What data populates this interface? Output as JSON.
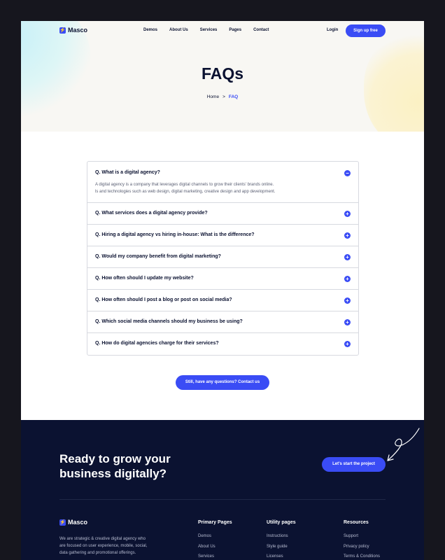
{
  "brand": {
    "name": "Masco",
    "logo_glyph": "⚡"
  },
  "nav": {
    "links": [
      "Demos",
      "About Us",
      "Services",
      "Pages",
      "Contact"
    ],
    "login": "Login",
    "signup": "Sign up free"
  },
  "hero": {
    "title": "FAQs",
    "breadcrumb": {
      "home": "Home",
      "separator": ">",
      "current": "FAQ"
    }
  },
  "faq": {
    "items": [
      {
        "question": "Q. What is a digital agency?",
        "expanded": true,
        "toggle": "−",
        "answer": [
          "A digital agency is a company that leverages digital channels to grow their clients' brands online.",
          "ls and technologies such as web design, digital marketing, creative design and app development."
        ]
      },
      {
        "question": "Q. What services does a digital agency provide?",
        "expanded": false,
        "toggle": "+"
      },
      {
        "question": "Q. Hiring a digital agency vs hiring in-house: What is the difference?",
        "expanded": false,
        "toggle": "+"
      },
      {
        "question": "Q. Would my company benefit from digital marketing?",
        "expanded": false,
        "toggle": "+"
      },
      {
        "question": "Q. How often should I update my website?",
        "expanded": false,
        "toggle": "+"
      },
      {
        "question": "Q. How often should I post a blog or post on social media?",
        "expanded": false,
        "toggle": "+"
      },
      {
        "question": "Q. Which social media channels should my business be using?",
        "expanded": false,
        "toggle": "+"
      },
      {
        "question": "Q. How do digital agencies charge for their services?",
        "expanded": false,
        "toggle": "+"
      }
    ],
    "contact_button": "Still, have any questions? Contact us"
  },
  "footer": {
    "cta_heading": [
      "Ready to grow your",
      "business digitally?"
    ],
    "cta_button": "Let's start the project",
    "description": [
      "We are strategic & creative digital agency who",
      "are focused on user experience, mobile, social,",
      "data gathering and promotional offerings."
    ],
    "columns": [
      {
        "heading": "Primary Pages",
        "links": [
          "Demos",
          "About Us",
          "Services"
        ]
      },
      {
        "heading": "Utility pages",
        "links": [
          "Instructions",
          "Style guide",
          "Licenses"
        ]
      },
      {
        "heading": "Resources",
        "links": [
          "Support",
          "Privacy policy",
          "Terms & Conditions"
        ]
      }
    ]
  },
  "colors": {
    "accent": "#3a4cf5",
    "navy": "#0b1231",
    "hero_bg": "#f8f7f3"
  }
}
